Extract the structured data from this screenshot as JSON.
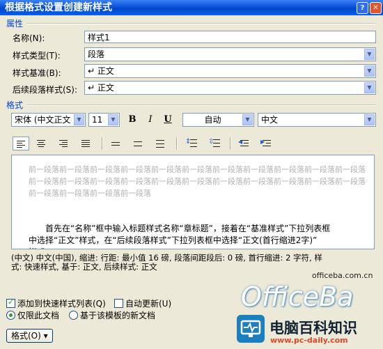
{
  "window": {
    "title": "根据格式设置创建新样式"
  },
  "properties": {
    "section_label": "属性",
    "name_label": "名称(N):",
    "name_value": "样式1",
    "style_type_label": "样式类型(T):",
    "style_type_value": "段落",
    "based_on_label": "样式基准(B):",
    "based_on_value": "↵ 正文",
    "next_style_label": "后续段落样式(S):",
    "next_style_value": "↵ 正文"
  },
  "format": {
    "section_label": "格式",
    "font": "宋体 (中文正文",
    "size": "11",
    "bold": "B",
    "italic": "I",
    "underline": "U",
    "color": "自动",
    "language": "中文"
  },
  "preview": {
    "prev_line1": "前一段落前一段落前一段落前一段落前一段落前一段落前一段落前一段落前一段落前一段落前一段落",
    "prev_line2": "前一段落前一段落前一段落前一段落前一段落前一段落前一段落前一段落前一段落前一段落前一段落",
    "prev_line3": "前一段落前一段落前一段落前一段落",
    "sample_line1": "首先在“名称”框中输入标题样式名称“章标题”，接着在“基准样式”下拉列表框",
    "sample_line2": "中选择“正文”样式，在“后续段落样式”下拉列表框中选择“正文(首行缩进2字)”",
    "sample_line3": "样式"
  },
  "description": {
    "line1": "(中文) 中文(中国), 缩进: 行距: 最小值 16 磅, 段落间距段后: 0 磅, 首行缩进: 2 字符, 样",
    "line2": "式: 快速样式, 基于: 正文, 后续样式: 正文"
  },
  "options": {
    "add_quick_style": "添加到快速样式列表(Q)",
    "auto_update": "自动更新(U)",
    "only_this_doc": "仅限此文档",
    "new_docs_template": "基于该模板的新文档",
    "format_button": "格式(O) ▾"
  },
  "watermark": {
    "site": "officeba.com.cn",
    "brand": "OfficeBa",
    "cn_name": "电脑百科知识",
    "url": "www.pc-daily.com"
  }
}
